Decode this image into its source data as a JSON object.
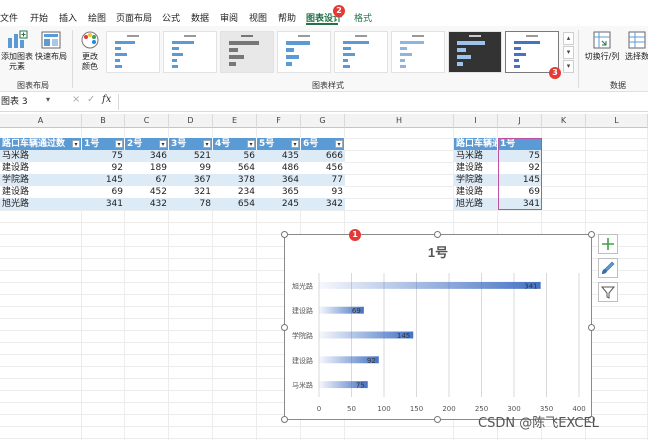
{
  "ribbon": {
    "tabs": [
      {
        "label": "文件",
        "x": 0
      },
      {
        "label": "开始",
        "x": 30
      },
      {
        "label": "插入",
        "x": 59
      },
      {
        "label": "绘图",
        "x": 88
      },
      {
        "label": "页面布局",
        "x": 116
      },
      {
        "label": "公式",
        "x": 162
      },
      {
        "label": "数据",
        "x": 191
      },
      {
        "label": "审阅",
        "x": 220
      },
      {
        "label": "视图",
        "x": 249
      },
      {
        "label": "帮助",
        "x": 278
      }
    ],
    "active_tab": "图表设计",
    "format_tab": "格式",
    "buttons": {
      "add_element": "添加图表\n元素",
      "quick_layout": "快速布局",
      "change_color": "更改\n颜色",
      "switch_row_col": "切换行/列",
      "select_data": "选择数"
    },
    "groups": {
      "layout": "图表布局",
      "styles": "图表样式",
      "data": "数据"
    },
    "badges": {
      "tab": "2",
      "style": "3",
      "chart": "1"
    },
    "accent": "#217346"
  },
  "formula_bar": {
    "name_box": "图表 3",
    "fx": "fx",
    "cancel": "×",
    "confirm": "✓"
  },
  "columns": [
    "A",
    "B",
    "C",
    "D",
    "E",
    "F",
    "G",
    "H",
    "I",
    "J",
    "K",
    "L"
  ],
  "table": {
    "headers": [
      "路口车辆通过数",
      "1号",
      "2号",
      "3号",
      "4号",
      "5号",
      "6号"
    ],
    "rows": [
      [
        "马米路",
        "75",
        "346",
        "521",
        "56",
        "435",
        "666"
      ],
      [
        "建设路",
        "92",
        "189",
        "99",
        "564",
        "486",
        "456"
      ],
      [
        "学院路",
        "145",
        "67",
        "367",
        "378",
        "364",
        "77"
      ],
      [
        "建设路",
        "69",
        "452",
        "321",
        "234",
        "365",
        "93"
      ],
      [
        "旭光路",
        "341",
        "432",
        "78",
        "654",
        "245",
        "342"
      ]
    ]
  },
  "table2": {
    "headers": [
      "路口车辆通",
      "1号"
    ],
    "rows": [
      [
        "马米路",
        "75"
      ],
      [
        "建设路",
        "92"
      ],
      [
        "学院路",
        "145"
      ],
      [
        "建设路",
        "69"
      ],
      [
        "旭光路",
        "341"
      ]
    ]
  },
  "chart_data": {
    "type": "bar",
    "orientation": "horizontal",
    "title": "1号",
    "categories": [
      "马米路",
      "建设路",
      "学院路",
      "建设路",
      "旭光路"
    ],
    "values": [
      75,
      92,
      145,
      69,
      341
    ],
    "xlim": [
      0,
      400
    ],
    "xticks": [
      0,
      50,
      100,
      150,
      200,
      250,
      300,
      350,
      400
    ],
    "grid": true,
    "bar_color": "#4472c4"
  },
  "watermark": "CSDN @陈飞EXCEL"
}
